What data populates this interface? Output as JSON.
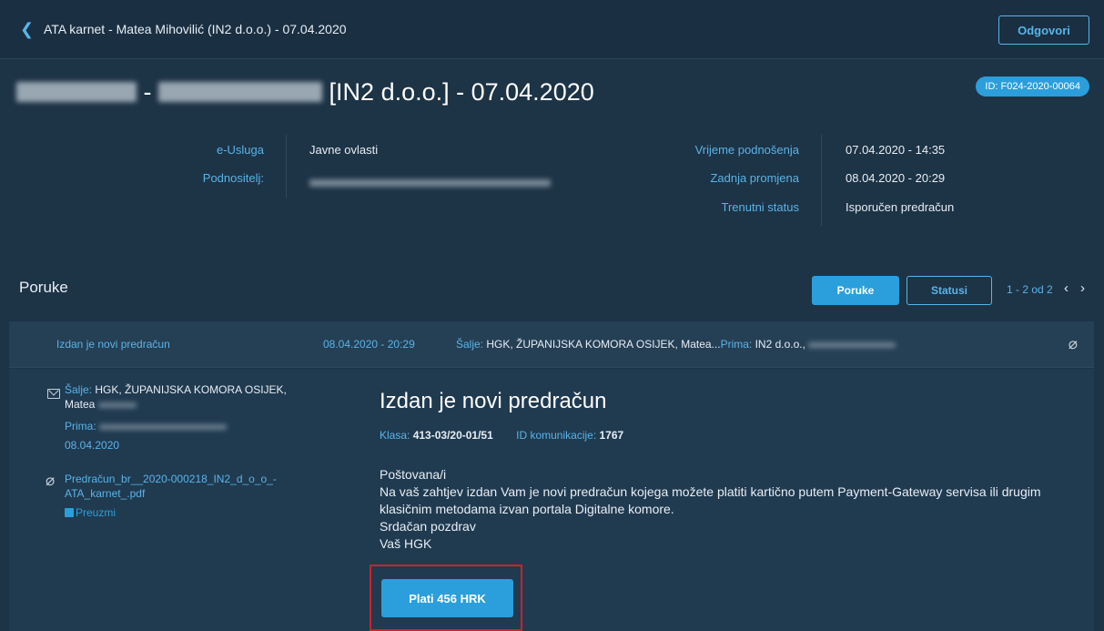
{
  "topbar": {
    "title": "ATA karnet - Matea Mihovilić (IN2 d.o.o.) - 07.04.2020",
    "reply_label": "Odgovori"
  },
  "header": {
    "title_separator": "-",
    "title_rest": "[IN2 d.o.o.] - 07.04.2020",
    "id_badge": "ID: F024-2020-00064",
    "left": [
      {
        "label": "e-Usluga",
        "value": "Javne ovlasti"
      },
      {
        "label": "Podnositelj:",
        "value": ""
      }
    ],
    "right": [
      {
        "label": "Vrijeme podnošenja",
        "value": "07.04.2020 - 14:35"
      },
      {
        "label": "Zadnja promjena",
        "value": "08.04.2020 - 20:29"
      },
      {
        "label": "Trenutni status",
        "value": "Isporučen predračun"
      }
    ]
  },
  "messages": {
    "title": "Poruke",
    "tab_messages": "Poruke",
    "tab_statuses": "Statusi",
    "pager": "1 - 2 od 2",
    "row": {
      "subject": "Izdan je novi predračun",
      "date": "08.04.2020 - 20:29",
      "sender_label": "Šalje:",
      "sender": "HGK, ŽUPANIJSKA KOMORA OSIJEK, Matea...",
      "recipient_label": "Prima:",
      "recipient": "IN2 d.o.o.,"
    }
  },
  "detail": {
    "sender_label": "Šalje:",
    "sender_line1": "HGK, ŽUPANIJSKA KOMORA OSIJEK,",
    "sender_line2": "Matea",
    "recipient_label": "Prima:",
    "date": "08.04.2020",
    "attachment_line1": "Predračun_br__2020-000218_IN2_d_o_o_-",
    "attachment_line2": "ATA_karnet_.pdf",
    "download_label": "Preuzmi",
    "heading": "Izdan je novi predračun",
    "klasa_label": "Klasa:",
    "klasa_value": "413-03/20-01/51",
    "comm_id_label": "ID komunikacije:",
    "comm_id_value": "1767",
    "body_line1": "Poštovana/i",
    "body_line2": "Na vaš zahtjev izdan Vam je novi predračun kojega možete platiti kartično putem Payment-Gateway servisa ili drugim klasičnim metodama izvan portala Digitalne komore.",
    "body_line3": "Srdačan pozdrav",
    "body_line4": "Vaš HGK",
    "pay_label": "Plati 456 HRK"
  },
  "colors": {
    "background": "#1d3346",
    "accent": "#2a9fdb",
    "link": "#5ab4e8",
    "highlight": "#d0202a"
  }
}
